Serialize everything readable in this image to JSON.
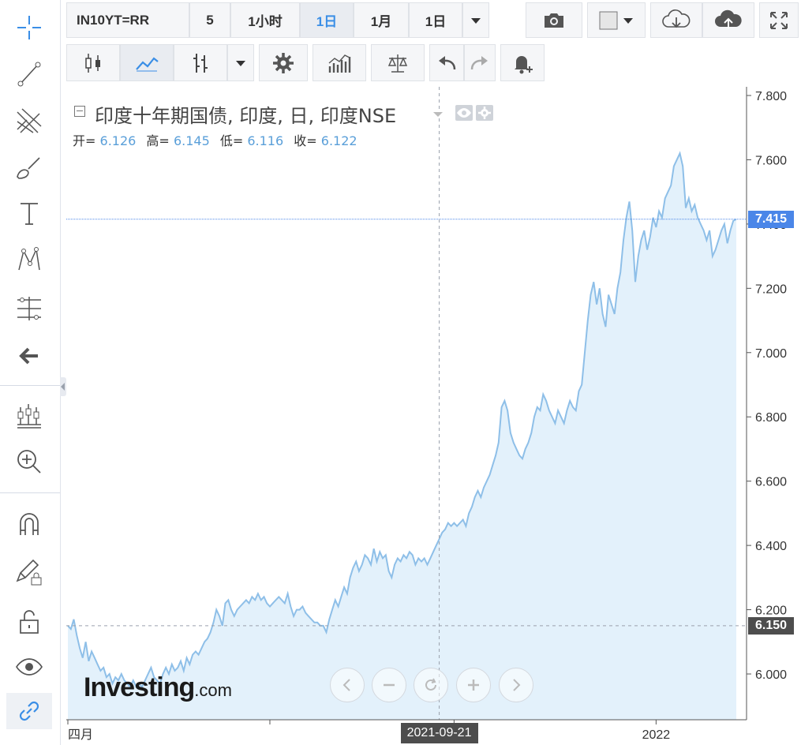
{
  "toolbar": {
    "symbol": "IN10YT=RR",
    "intervals": [
      "5",
      "1小时",
      "1日",
      "1月",
      "1日"
    ],
    "active_interval_index": 2
  },
  "legend": {
    "title": "印度十年期国债, 印度, 日, 印度NSE",
    "open_label": "开=",
    "open": "6.126",
    "high_label": "高=",
    "high": "6.145",
    "low_label": "低=",
    "low": "6.116",
    "close_label": "收=",
    "close": "6.122"
  },
  "price_tags": {
    "last": "7.415",
    "crosshair": "6.150"
  },
  "crosshair_date": "2021-09-21",
  "watermark": {
    "main": "Investing",
    "suffix": ".com"
  },
  "colors": {
    "line": "#8ebfe8",
    "fill": "#e3f1fb",
    "accent": "#3a8ee6",
    "last_tag": "#4a86e8",
    "crosshair_tag": "#4d4d4d"
  },
  "chart_data": {
    "type": "area",
    "title": "印度十年期国债, 印度, 日, 印度NSE",
    "xlabel": "",
    "ylabel": "",
    "ylim": [
      5.85,
      7.83
    ],
    "yticks": [
      6.0,
      6.2,
      6.4,
      6.6,
      6.8,
      7.0,
      7.2,
      7.4,
      7.6,
      7.8
    ],
    "ytick_labels": [
      "6.000",
      "6.200",
      "6.400",
      "6.600",
      "6.800",
      "7.000",
      "7.200",
      "7.400",
      "7.600",
      "7.800"
    ],
    "x_labels": [
      {
        "label": "四月",
        "index": 0
      },
      {
        "label": "2022",
        "index": 198
      }
    ],
    "x_tick_indices": [
      0,
      68,
      130,
      198,
      263,
      325
    ],
    "crosshair": {
      "index": 125,
      "value": 6.15
    },
    "last_value": 7.415,
    "series": [
      {
        "values": [
          6.15,
          6.14,
          6.17,
          6.12,
          6.08,
          6.05,
          6.1,
          6.04,
          6.07,
          6.05,
          6.03,
          6.01,
          6.02,
          5.99,
          6.0,
          5.97,
          5.99,
          5.98,
          6.0,
          5.98,
          5.97,
          5.96,
          5.98,
          5.96,
          5.97,
          5.96,
          5.98,
          6.0,
          6.02,
          5.99,
          5.98,
          5.97,
          6.0,
          6.02,
          6.0,
          6.03,
          6.01,
          6.02,
          6.04,
          6.01,
          6.05,
          6.03,
          6.06,
          6.07,
          6.06,
          6.08,
          6.1,
          6.11,
          6.13,
          6.16,
          6.2,
          6.18,
          6.15,
          6.22,
          6.23,
          6.2,
          6.18,
          6.2,
          6.21,
          6.22,
          6.23,
          6.22,
          6.24,
          6.23,
          6.25,
          6.23,
          6.24,
          6.22,
          6.21,
          6.22,
          6.23,
          6.24,
          6.23,
          6.22,
          6.25,
          6.21,
          6.18,
          6.2,
          6.2,
          6.21,
          6.19,
          6.18,
          6.17,
          6.16,
          6.16,
          6.15,
          6.15,
          6.13,
          6.17,
          6.2,
          6.23,
          6.21,
          6.24,
          6.27,
          6.25,
          6.3,
          6.33,
          6.35,
          6.32,
          6.34,
          6.37,
          6.36,
          6.34,
          6.39,
          6.35,
          6.38,
          6.36,
          6.37,
          6.32,
          6.3,
          6.34,
          6.36,
          6.35,
          6.37,
          6.36,
          6.38,
          6.37,
          6.34,
          6.36,
          6.35,
          6.36,
          6.34,
          6.36,
          6.38,
          6.4,
          6.42,
          6.44,
          6.45,
          6.47,
          6.46,
          6.47,
          6.46,
          6.47,
          6.48,
          6.46,
          6.5,
          6.52,
          6.55,
          6.57,
          6.55,
          6.58,
          6.6,
          6.62,
          6.65,
          6.68,
          6.72,
          6.83,
          6.85,
          6.82,
          6.75,
          6.72,
          6.7,
          6.68,
          6.67,
          6.7,
          6.72,
          6.75,
          6.8,
          6.83,
          6.82,
          6.87,
          6.85,
          6.82,
          6.8,
          6.78,
          6.82,
          6.8,
          6.78,
          6.82,
          6.85,
          6.83,
          6.82,
          6.88,
          6.9,
          7.0,
          7.1,
          7.18,
          7.22,
          7.15,
          7.2,
          7.12,
          7.08,
          7.18,
          7.15,
          7.12,
          7.2,
          7.25,
          7.35,
          7.42,
          7.47,
          7.38,
          7.22,
          7.3,
          7.35,
          7.38,
          7.32,
          7.36,
          7.42,
          7.39,
          7.44,
          7.42,
          7.48,
          7.5,
          7.52,
          7.58,
          7.6,
          7.62,
          7.58,
          7.45,
          7.48,
          7.44,
          7.46,
          7.42,
          7.4,
          7.38,
          7.35,
          7.38,
          7.3,
          7.32,
          7.35,
          7.38,
          7.4,
          7.34,
          7.38,
          7.41,
          7.415
        ]
      }
    ]
  }
}
